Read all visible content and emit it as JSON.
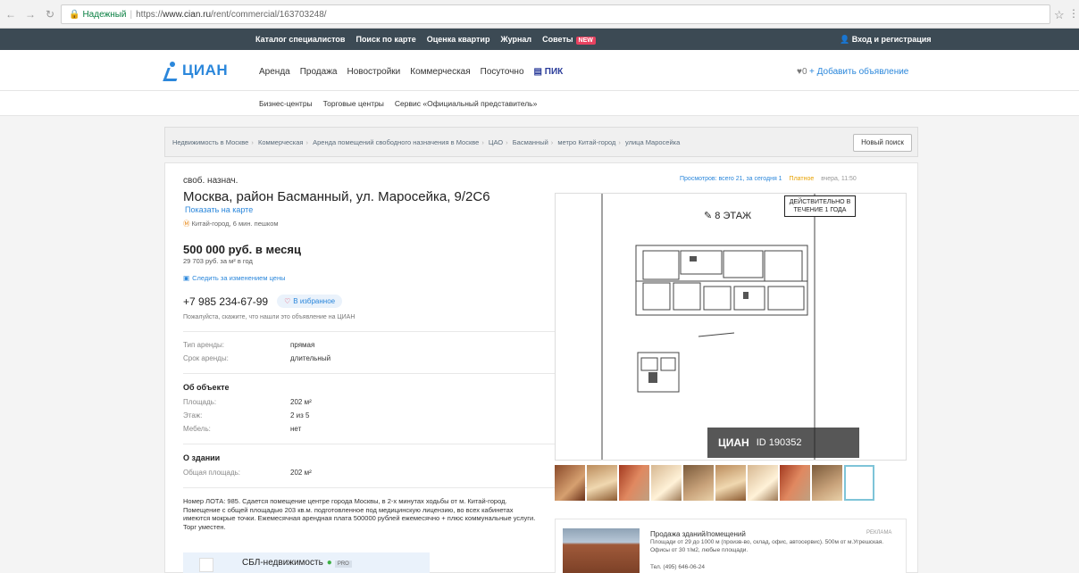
{
  "browser": {
    "secure_label": "Надежный",
    "url_prefix": "https://",
    "url_host": "www.cian.ru",
    "url_path": "/rent/commercial/163703248/"
  },
  "topbar": {
    "links": [
      "Каталог специалистов",
      "Поиск по карте",
      "Оценка квартир",
      "Журнал",
      "Советы"
    ],
    "new_badge": "NEW",
    "login": "Вход и регистрация"
  },
  "header": {
    "logo": "ЦИАН",
    "nav": [
      "Аренда",
      "Продажа",
      "Новостройки",
      "Коммерческая",
      "Посуточно"
    ],
    "pik": "ПИК",
    "fav_count": "♥0",
    "add_listing": "+ Добавить объявление"
  },
  "subnav": {
    "links": [
      "Бизнес-центры",
      "Торговые центры",
      "Сервис «Официальный представитель»"
    ]
  },
  "breadcrumbs": {
    "items": [
      "Недвижимость в Москве",
      "Коммерческая",
      "Аренда помещений свободного назначения в Москве",
      "ЦАО",
      "Басманный",
      "метро Китай-город",
      "улица Маросейка"
    ],
    "new_search": "Новый поиск"
  },
  "offer": {
    "type": "своб. назнач.",
    "address": "Москва, район Басманный, ул. Маросейка, 9/2С6",
    "show_map": "Показать на карте",
    "metro": "Китай-город, 6 мин. пешком",
    "price": "500 000 руб. в месяц",
    "price_per_m2": "29 703 руб. за м² в год",
    "track_price": "Следить за изменением цены",
    "phone": "+7 985 234-67-99",
    "favorite": "В избранное",
    "call_note": "Пожалуйста, скажите, что нашли это объявление на ЦИАН",
    "rent_terms": [
      {
        "k": "Тип аренды:",
        "v": "прямая"
      },
      {
        "k": "Срок аренды:",
        "v": "длительный"
      }
    ],
    "object_title": "Об объекте",
    "object_props": [
      {
        "k": "Площадь:",
        "v": "202 м²"
      },
      {
        "k": "Этаж:",
        "v": "2 из 5"
      },
      {
        "k": "Мебель:",
        "v": "нет"
      }
    ],
    "building_title": "О здании",
    "building_props": [
      {
        "k": "Общая площадь:",
        "v": "202 м²"
      }
    ],
    "description": "Номер ЛОТА: 985. Сдается помещение центре города Москвы, в 2-х минутах ходьбы от м. Китай-город. Помещение с общей площадью 203 кв.м. подготовленное под медицинскую лицензию, во всех кабинетах имеются мокрые точки. Ежемесячная арендная плата 500000 рублей ежемесячно + плюс коммунальные услуги. Торг уместен.",
    "agent_name": "СБЛ-недвижимость",
    "agent_badge": "PRO"
  },
  "media": {
    "stats": "Просмотров: всего 21, за сегодня 1",
    "paid": "Платное",
    "id": "вчера, 11:50",
    "floor_label": "8 ЭТАЖ",
    "valid_note": "ДЕЙСТВИТЕЛЬНО В ТЕЧЕНИЕ 1 ГОДА",
    "watermark": "ЦИАН",
    "watermark_id": "ID 190352"
  },
  "ad": {
    "title": "Продажа зданий/помещений",
    "text": "Площади от 29 до 1000 м (произв-во, склад, офис, автосервис). 500м от м.Угрешская. Офисы от 30 т/м2, любые площади.",
    "tel": "Тел. (495) 646-06-24",
    "label": "РЕКЛАМА"
  }
}
